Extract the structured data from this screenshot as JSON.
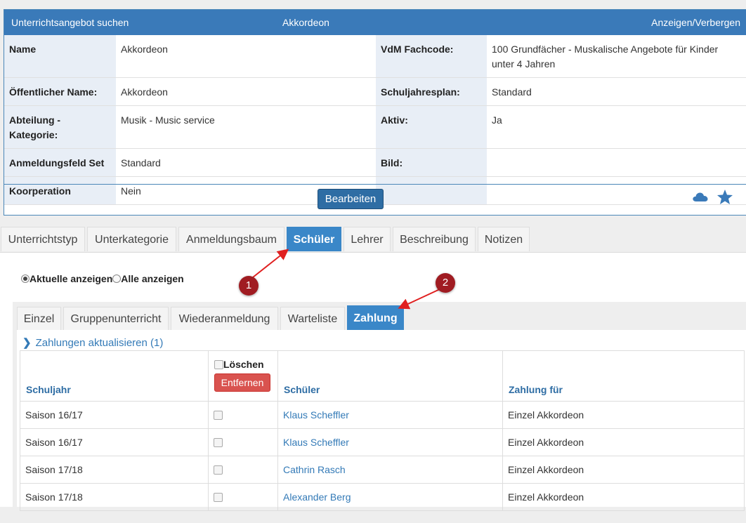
{
  "header": {
    "left": "Unterrichtsangebot suchen",
    "center": "Akkordeon",
    "right": "Anzeigen/Verbergen"
  },
  "details": {
    "name_label": "Name",
    "name_value": "Akkordeon",
    "vdm_label": "VdM Fachcode:",
    "vdm_value": "100 Grundfächer - Muskalische Angebote für Kinder unter 4 Jahren",
    "public_label": "Öffentlicher Name:",
    "public_value": "Akkordeon",
    "plan_label": "Schuljahresplan:",
    "plan_value": "Standard",
    "dept_label": "Abteilung - Kategorie:",
    "dept_value": "Musik - Music service",
    "active_label": "Aktiv:",
    "active_value": "Ja",
    "field_label": "Anmeldungsfeld Set",
    "field_value": "Standard",
    "image_label": "Bild:",
    "image_value": "",
    "coop_label": "Koorperation",
    "coop_value": "Nein"
  },
  "edit_button": "Bearbeiten",
  "icons": {
    "cloud": "cloud-icon",
    "star": "star-icon",
    "accent": "#3a7ab9"
  },
  "main_tabs": [
    "Unterrichtstyp",
    "Unterkategorie",
    "Anmeldungsbaum",
    "Schüler",
    "Lehrer",
    "Beschreibung",
    "Notizen"
  ],
  "main_tab_active": "Schüler",
  "radio": {
    "current": "Aktuelle anzeigen",
    "all": "Alle anzeigen"
  },
  "sub_tabs": [
    "Einzel",
    "Gruppenunterricht",
    "Wiederanmeldung",
    "Warteliste",
    "Zahlung"
  ],
  "sub_tab_active": "Zahlung",
  "refresh_link": "Zahlungen aktualisieren (1)",
  "table": {
    "col_year": "Schuljahr",
    "col_delete": "Löschen",
    "remove_button": "Entfernen",
    "col_student": "Schüler",
    "col_payment": "Zahlung für",
    "rows": [
      {
        "year": "Saison 16/17",
        "student": "Klaus Scheffler",
        "payment": "Einzel Akkordeon"
      },
      {
        "year": "Saison 16/17",
        "student": "Klaus Scheffler",
        "payment": "Einzel Akkordeon"
      },
      {
        "year": "Saison 17/18",
        "student": "Cathrin Rasch",
        "payment": "Einzel Akkordeon"
      },
      {
        "year": "Saison 17/18",
        "student": "Alexander Berg",
        "payment": "Einzel Akkordeon"
      }
    ]
  },
  "markers": [
    "1",
    "2"
  ]
}
